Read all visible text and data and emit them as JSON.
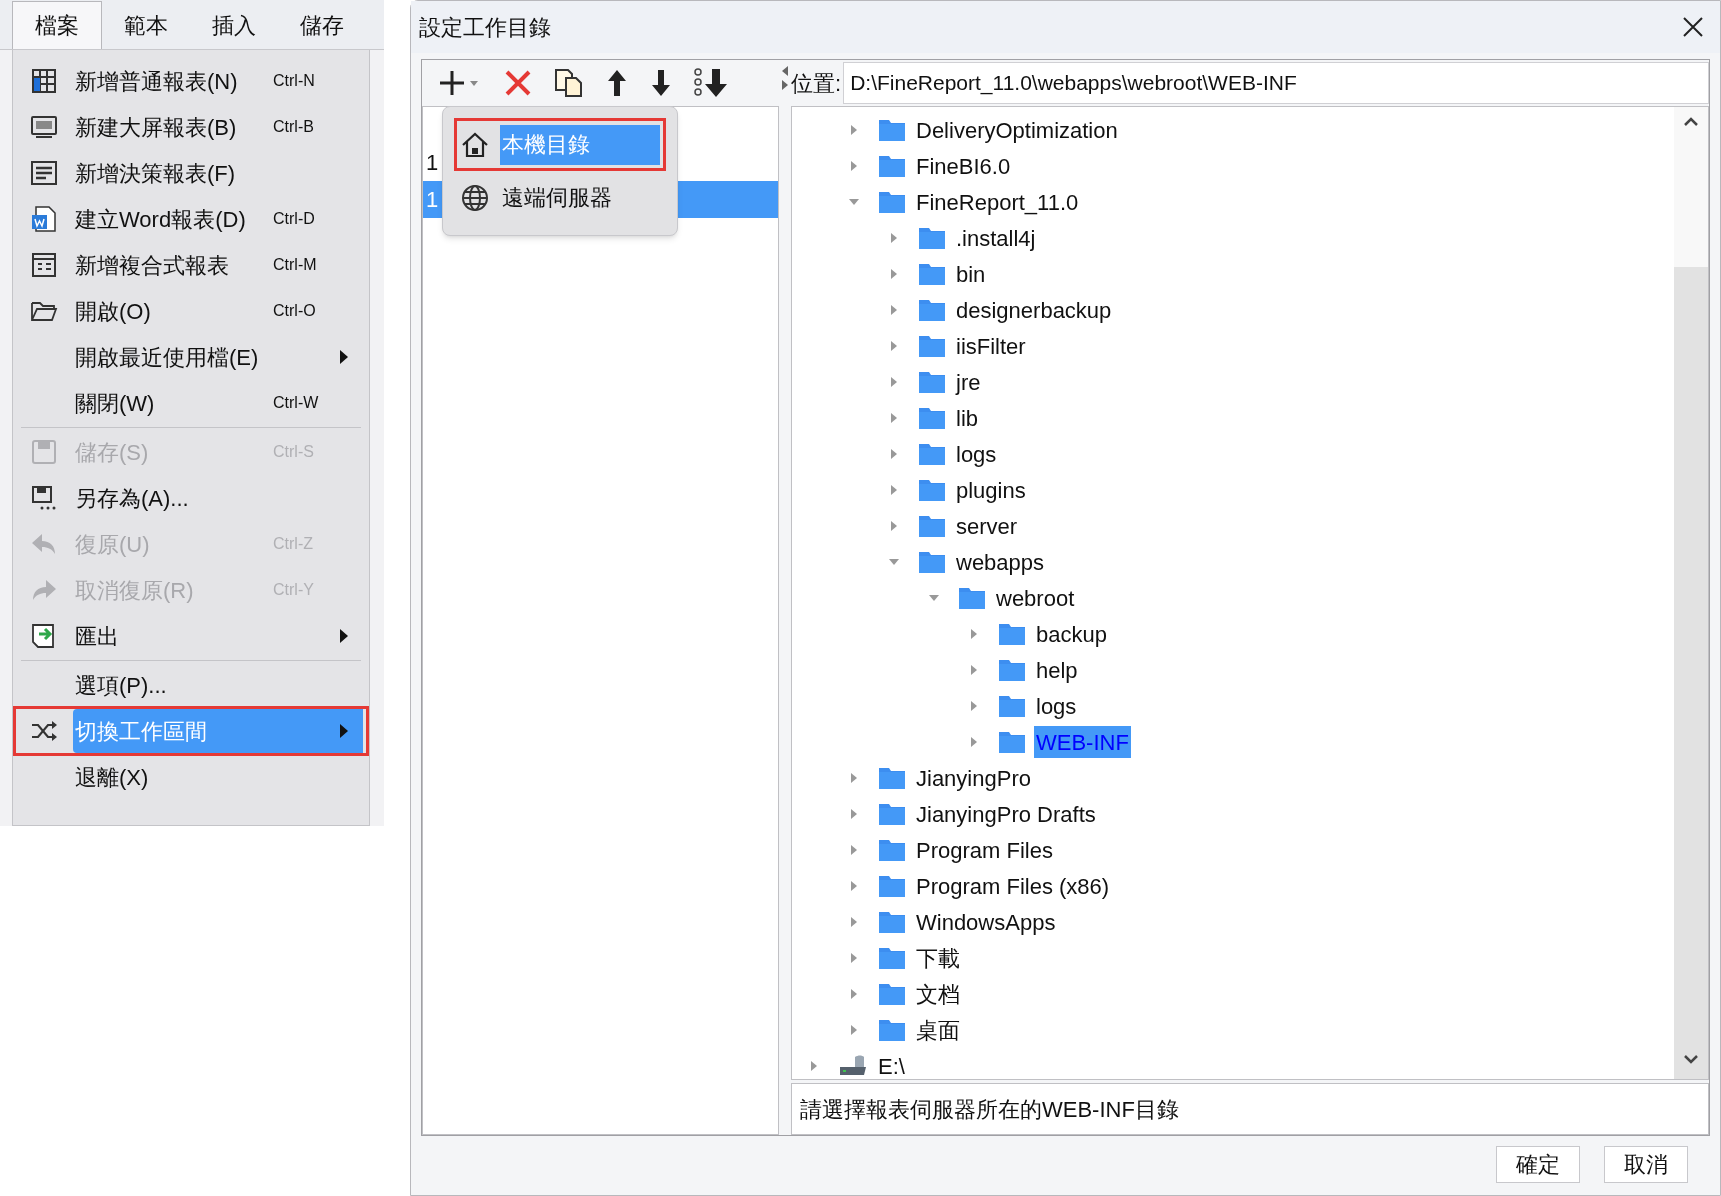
{
  "menu_bar": {
    "tabs": [
      {
        "label": "檔案",
        "selected": true
      },
      {
        "label": "範本",
        "selected": false
      },
      {
        "label": "插入",
        "selected": false
      },
      {
        "label": "儲存",
        "selected": false
      }
    ]
  },
  "file_menu": {
    "groups": [
      [
        {
          "kind": "grid",
          "label": "新增普通報表(N)",
          "shortcut": "Ctrl-N",
          "disabled": false,
          "selected": false,
          "submenu": false,
          "highlighted": false
        },
        {
          "kind": "screen",
          "label": "新建大屏報表(B)",
          "shortcut": "Ctrl-B",
          "disabled": false,
          "selected": false,
          "submenu": false,
          "highlighted": false
        },
        {
          "kind": "dashboard",
          "label": "新增決策報表(F)",
          "disabled": false,
          "selected": false,
          "submenu": false,
          "highlighted": false
        },
        {
          "kind": "word",
          "label": "建立Word報表(D)",
          "shortcut": "Ctrl-D",
          "disabled": false,
          "selected": false,
          "submenu": false,
          "highlighted": false
        },
        {
          "kind": "form",
          "label": "新增複合式報表",
          "shortcut": "Ctrl-M",
          "disabled": false,
          "selected": false,
          "submenu": false,
          "highlighted": false
        },
        {
          "kind": "folder",
          "label": "開啟(O)",
          "shortcut": "Ctrl-O",
          "disabled": false,
          "selected": false,
          "submenu": false,
          "highlighted": false
        },
        {
          "kind": "plain",
          "label": "開啟最近使用檔(E)",
          "disabled": false,
          "selected": false,
          "submenu": true,
          "highlighted": false
        },
        {
          "kind": "plain",
          "label": "關閉(W)",
          "shortcut": "Ctrl-W",
          "disabled": false,
          "selected": false,
          "submenu": false,
          "highlighted": false
        }
      ],
      [
        {
          "kind": "save",
          "label": "儲存(S)",
          "shortcut": "Ctrl-S",
          "disabled": true,
          "selected": false,
          "submenu": false,
          "highlighted": false
        },
        {
          "kind": "saveas",
          "label": "另存為(A)...",
          "disabled": false,
          "selected": false,
          "submenu": false,
          "highlighted": false
        },
        {
          "kind": "undo",
          "label": "復原(U)",
          "shortcut": "Ctrl-Z",
          "disabled": true,
          "selected": false,
          "submenu": false,
          "highlighted": false
        },
        {
          "kind": "redo",
          "label": "取消復原(R)",
          "shortcut": "Ctrl-Y",
          "disabled": true,
          "selected": false,
          "submenu": false,
          "highlighted": false
        },
        {
          "kind": "export",
          "label": "匯出",
          "disabled": false,
          "selected": false,
          "submenu": true,
          "highlighted": false
        }
      ],
      [
        {
          "kind": "plain",
          "label": "選項(P)...",
          "disabled": false,
          "selected": false,
          "submenu": false,
          "highlighted": false
        },
        {
          "kind": "shuffle",
          "label": "切換工作區間",
          "disabled": false,
          "selected": true,
          "submenu": true,
          "highlighted": true
        },
        {
          "kind": "plain",
          "label": "退離(X)",
          "disabled": false,
          "selected": false,
          "submenu": false,
          "highlighted": false
        }
      ]
    ]
  },
  "dialog": {
    "title": "設定工作目錄",
    "list": [
      {
        "label": "1",
        "selected": false
      },
      {
        "label": "1",
        "selected": true
      }
    ],
    "add_popup": [
      {
        "kind": "home",
        "label": "本機目錄",
        "selected": true,
        "highlighted": true
      },
      {
        "kind": "globe",
        "label": "遠端伺服器",
        "selected": false,
        "highlighted": false
      }
    ],
    "location": {
      "label": "位置:",
      "value": "D:\\FineReport_11.0\\webapps\\webroot\\WEB-INF"
    },
    "tree": [
      {
        "kind": "folder",
        "label": "DeliveryOptimization",
        "expanded": false,
        "selected": false
      },
      {
        "kind": "folder",
        "label": "FineBI6.0",
        "expanded": false,
        "selected": false
      },
      {
        "kind": "folder",
        "label": "FineReport_11.0",
        "expanded": true,
        "selected": false,
        "children": [
          {
            "kind": "folder",
            "label": ".install4j",
            "expanded": false,
            "selected": false
          },
          {
            "kind": "folder",
            "label": "bin",
            "expanded": false,
            "selected": false
          },
          {
            "kind": "folder",
            "label": "designerbackup",
            "expanded": false,
            "selected": false
          },
          {
            "kind": "folder",
            "label": "iisFilter",
            "expanded": false,
            "selected": false
          },
          {
            "kind": "folder",
            "label": "jre",
            "expanded": false,
            "selected": false
          },
          {
            "kind": "folder",
            "label": "lib",
            "expanded": false,
            "selected": false
          },
          {
            "kind": "folder",
            "label": "logs",
            "expanded": false,
            "selected": false
          },
          {
            "kind": "folder",
            "label": "plugins",
            "expanded": false,
            "selected": false
          },
          {
            "kind": "folder",
            "label": "server",
            "expanded": false,
            "selected": false
          },
          {
            "kind": "folder",
            "label": "webapps",
            "expanded": true,
            "selected": false,
            "children": [
              {
                "kind": "folder",
                "label": "webroot",
                "expanded": true,
                "selected": false,
                "children": [
                  {
                    "kind": "folder",
                    "label": "backup",
                    "expanded": false,
                    "selected": false
                  },
                  {
                    "kind": "folder",
                    "label": "help",
                    "expanded": false,
                    "selected": false
                  },
                  {
                    "kind": "folder",
                    "label": "logs",
                    "expanded": false,
                    "selected": false
                  },
                  {
                    "kind": "folder",
                    "label": "WEB-INF",
                    "expanded": false,
                    "selected": true
                  }
                ]
              }
            ]
          }
        ]
      },
      {
        "kind": "folder",
        "label": "JianyingPro",
        "expanded": false,
        "selected": false
      },
      {
        "kind": "folder",
        "label": "JianyingPro Drafts",
        "expanded": false,
        "selected": false
      },
      {
        "kind": "folder",
        "label": "Program Files",
        "expanded": false,
        "selected": false
      },
      {
        "kind": "folder",
        "label": "Program Files (x86)",
        "expanded": false,
        "selected": false
      },
      {
        "kind": "folder",
        "label": "WindowsApps",
        "expanded": false,
        "selected": false
      },
      {
        "kind": "folder",
        "label": "下載",
        "expanded": false,
        "selected": false
      },
      {
        "kind": "folder",
        "label": "文档",
        "expanded": false,
        "selected": false
      },
      {
        "kind": "folder",
        "label": "桌面",
        "expanded": false,
        "selected": false
      }
    ],
    "drives": [
      {
        "kind": "drive",
        "label": "E:\\",
        "expanded": false,
        "selected": false
      }
    ],
    "hint": "請選擇報表伺服器所在的WEB-INF目錄",
    "buttons": [
      "確定",
      "取消"
    ]
  }
}
